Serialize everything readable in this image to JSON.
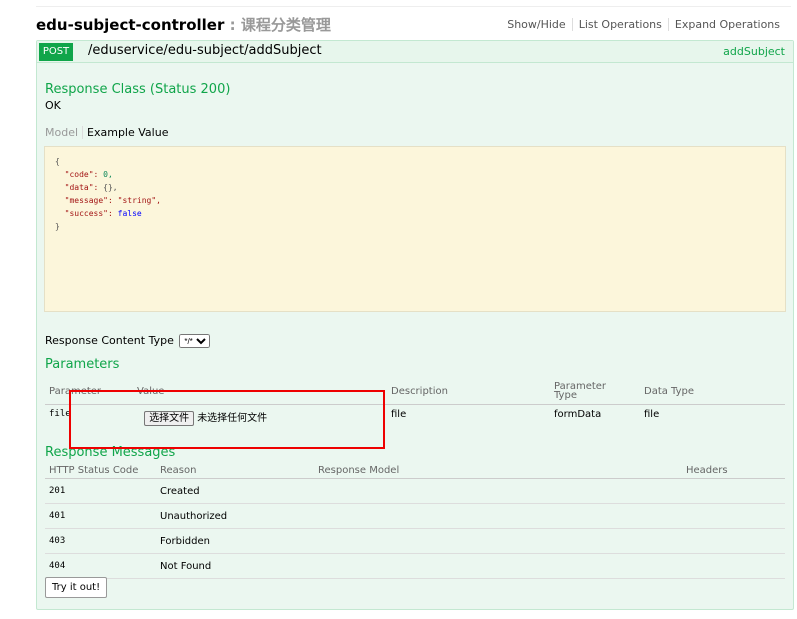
{
  "controller": {
    "name": "edu-subject-controller",
    "separator": " : ",
    "description": "课程分类管理",
    "links": [
      "Show/Hide",
      "List Operations",
      "Expand Operations"
    ]
  },
  "operation": {
    "method": "POST",
    "path": "/eduservice/edu-subject/addSubject",
    "nickname": "addSubject",
    "response_class_title": "Response Class (Status 200)",
    "response_class_value": "OK",
    "model_tabs": [
      "Model",
      "Example Value"
    ],
    "example_lines": [
      [
        "{",
        "",
        ""
      ],
      [
        "  ",
        "\"code\": ",
        "0,"
      ],
      [
        "  ",
        "\"data\": ",
        "{},"
      ],
      [
        "  ",
        "\"message\": ",
        "\"string\","
      ],
      [
        "  ",
        "\"success\": ",
        "false"
      ],
      [
        "}",
        "",
        ""
      ]
    ],
    "response_content_type_label": "Response Content Type",
    "response_content_type_value": "*/*",
    "parameters_title": "Parameters",
    "param_headers": [
      "Parameter",
      "Value",
      "Description",
      "Parameter\nType",
      "Data Type"
    ],
    "params": [
      {
        "name": "file",
        "button": "选择文件",
        "file_status": "未选择任何文件",
        "description": "file",
        "param_type": "formData",
        "data_type": "file"
      }
    ],
    "response_messages_title": "Response Messages",
    "response_headers": [
      "HTTP Status Code",
      "Reason",
      "Response Model",
      "Headers"
    ],
    "responses": [
      {
        "code": "201",
        "reason": "Created"
      },
      {
        "code": "401",
        "reason": "Unauthorized"
      },
      {
        "code": "403",
        "reason": "Forbidden"
      },
      {
        "code": "404",
        "reason": "Not Found"
      }
    ],
    "try_button": "Try it out!"
  }
}
